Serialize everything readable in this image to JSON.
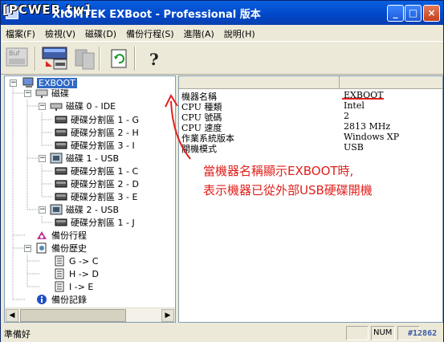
{
  "window": {
    "watermark": "[PCWEB.tw]",
    "title": "XIOMTEK EXBoot - Professional 版本"
  },
  "menu": [
    "檔案(F)",
    "檢視(V)",
    "磁碟(D)",
    "備份行程(S)",
    "進階(A)",
    "說明(H)"
  ],
  "toolbar": {
    "help_glyph": "?",
    "icons": [
      "buf-icon",
      "disk-config-icon",
      "copy-icon",
      "refresh-icon",
      "help-icon"
    ]
  },
  "tree": {
    "root": "EXBOOT",
    "disks_label": "磁碟",
    "disk0": "磁碟 0 - IDE",
    "disk0_parts": [
      "硬碟分割區 1 - G",
      "硬碟分割區 2 - H",
      "硬碟分割區 3 - I"
    ],
    "disk1": "磁碟 1 - USB",
    "disk1_parts": [
      "硬碟分割區 1 - C",
      "硬碟分割區 2 - D",
      "硬碟分割區 3 - E"
    ],
    "disk2": "磁碟 2 - USB",
    "disk2_parts": [
      "硬碟分割區 1 - J"
    ],
    "backup_process": "備份行程",
    "backup_history": "備份歷史",
    "history_items": [
      "G -> C",
      "H -> D",
      "I -> E"
    ],
    "backup_log": "備份記錄"
  },
  "properties": [
    {
      "key": "機器名稱",
      "value": "EXBOOT"
    },
    {
      "key": "CPU 種類",
      "value": "Intel"
    },
    {
      "key": "CPU 號碼",
      "value": "2"
    },
    {
      "key": "CPU 速度",
      "value": "2813 MHz"
    },
    {
      "key": "作業系統版本",
      "value": "Windows XP"
    },
    {
      "key": "開機模式",
      "value": "USB"
    }
  ],
  "annotation": {
    "line1": "當機器名稱顯示EXBOOT時,",
    "line2": "表示機器已從外部USB硬碟開機"
  },
  "status": {
    "text": "準備好",
    "num": "NUM",
    "image_id": "#12862"
  },
  "colors": {
    "accent": "#316ac5",
    "annotation": "#e0201c",
    "titlebar": "#0a5fe0"
  }
}
